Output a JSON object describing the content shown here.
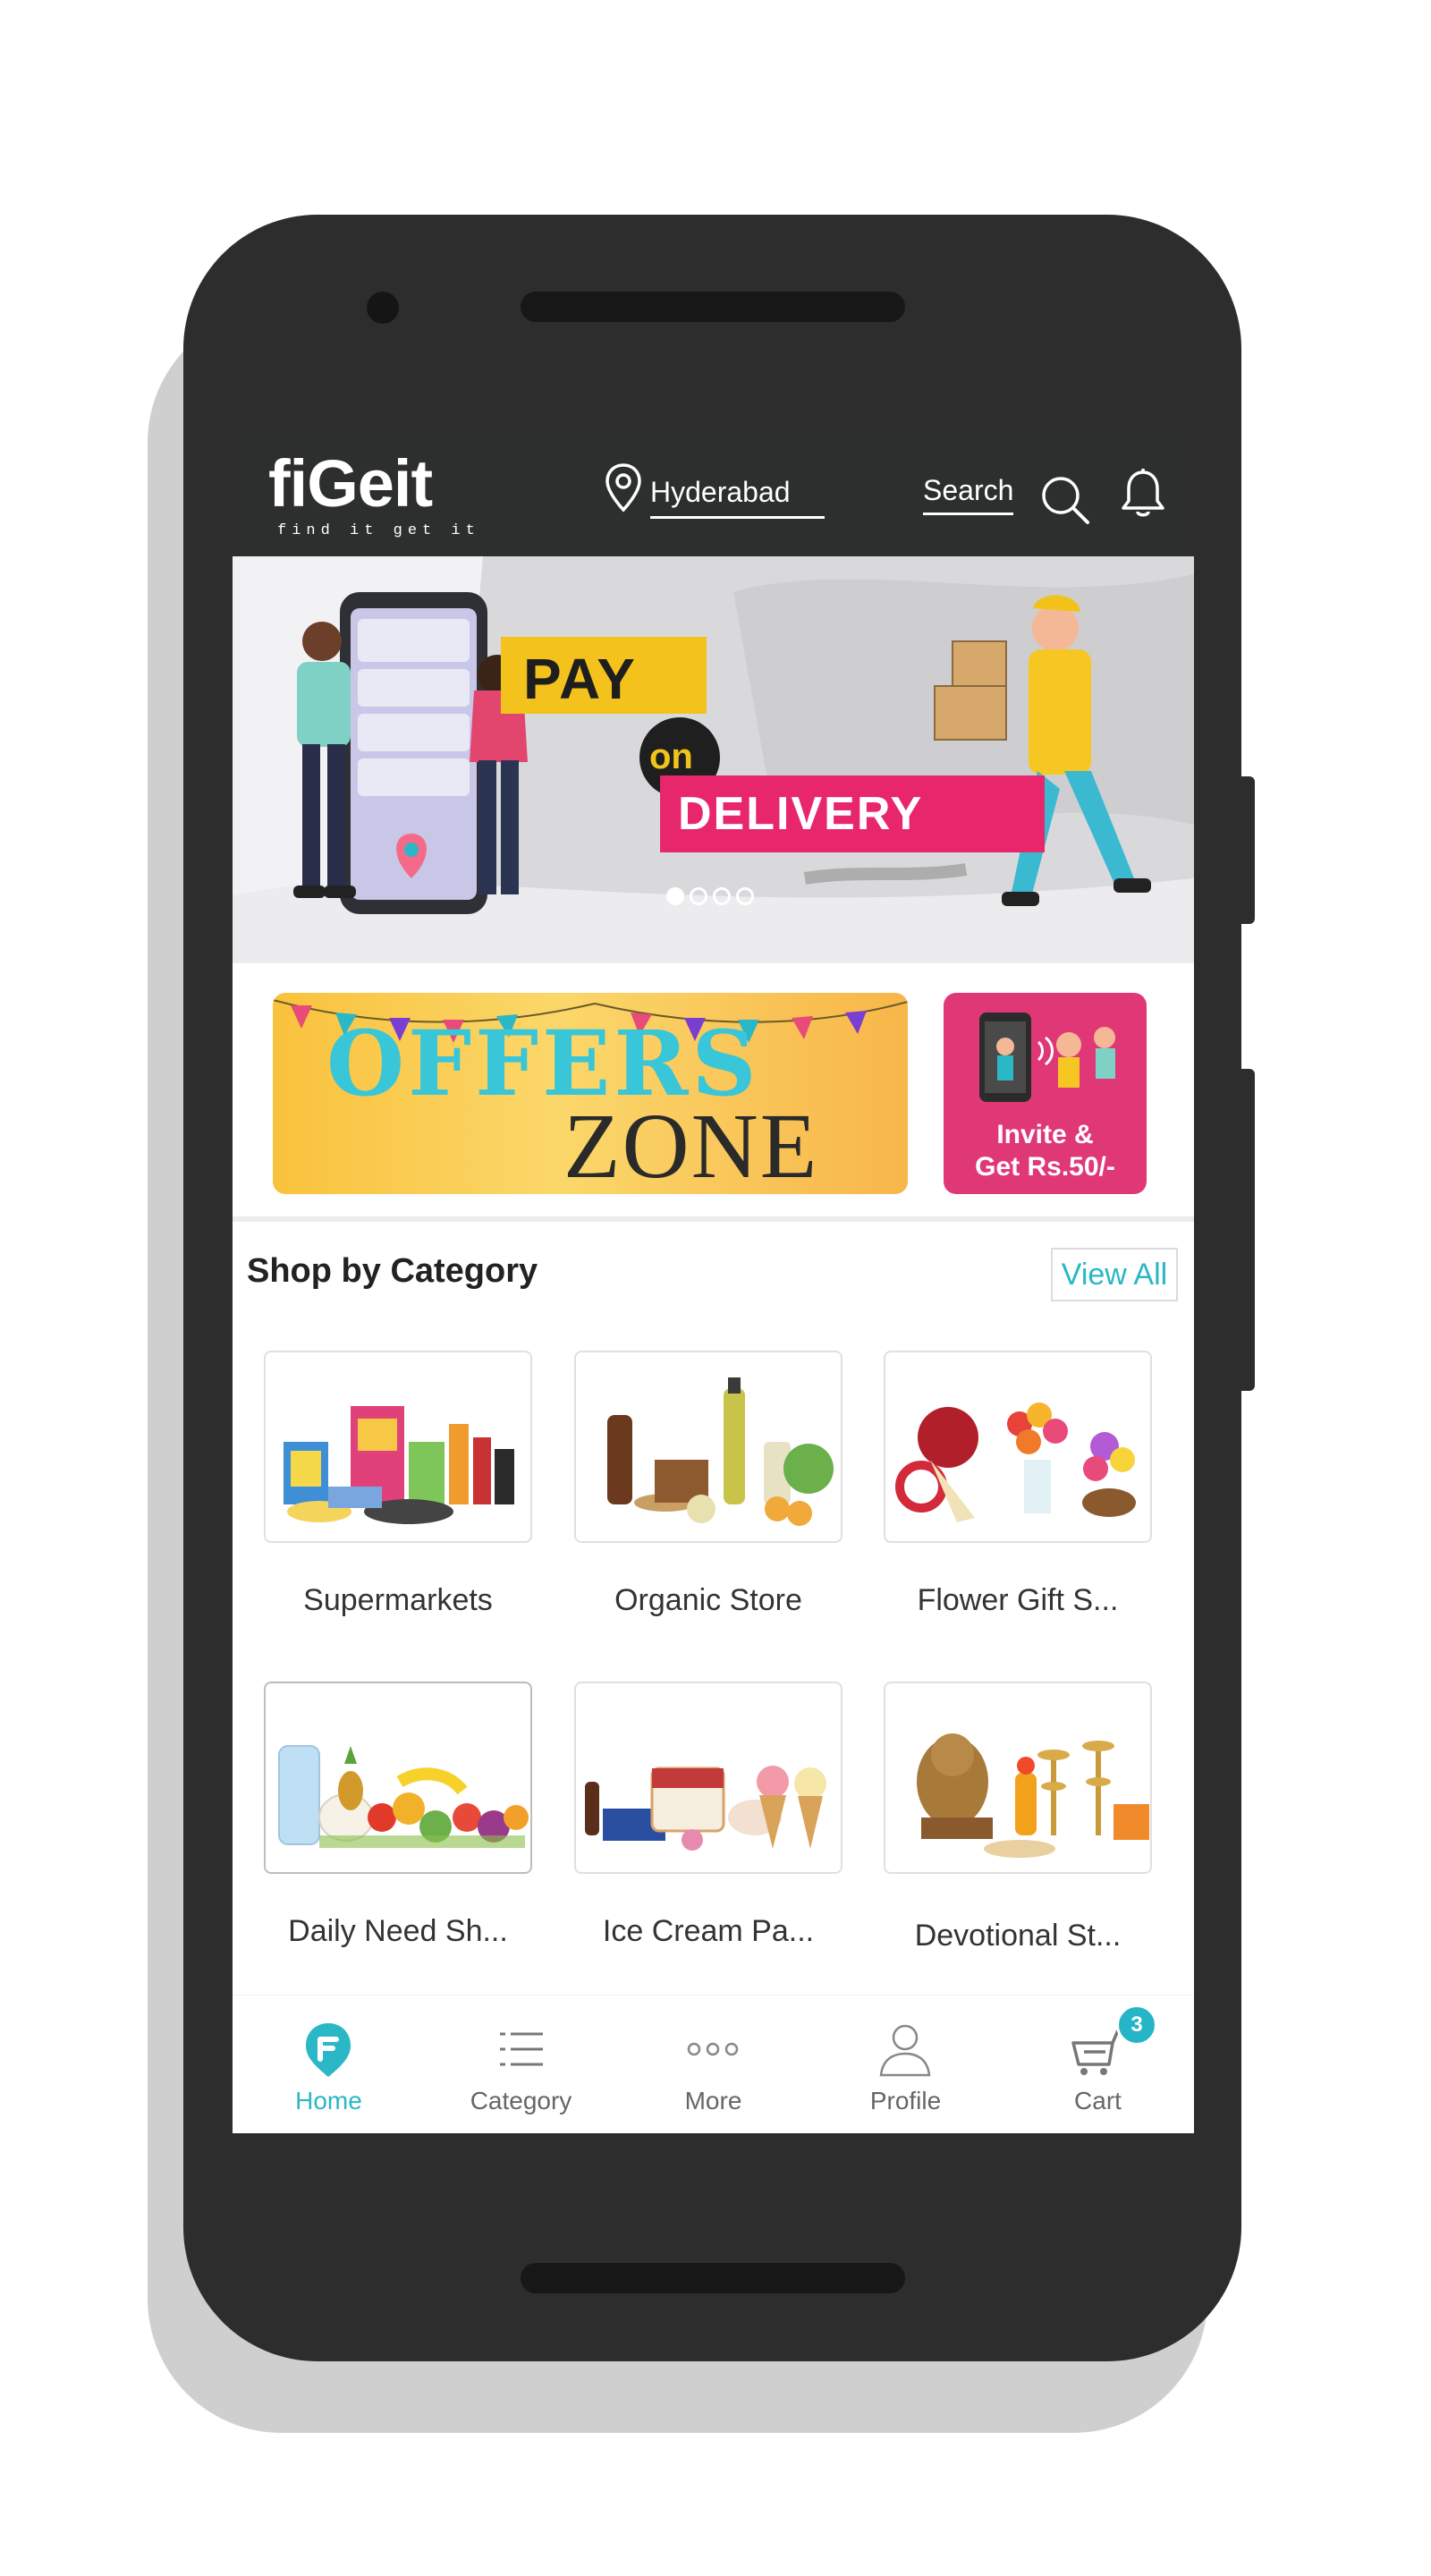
{
  "header": {
    "logo_text": "fiGeit",
    "logo_tagline": "find it get it",
    "location": "Hyderabad",
    "search_label": "Search"
  },
  "banner": {
    "line1": "PAY",
    "line2": "on",
    "line3": "DELIVERY",
    "slide_count": 4,
    "active_slide": 0
  },
  "offers": {
    "title": "OFFERS",
    "subtitle": "ZONE",
    "invite_line1": "Invite & ",
    "invite_line2": "Get Rs.50/-"
  },
  "category_section": {
    "title": "Shop by Category",
    "view_all": "View All",
    "items": [
      {
        "label": "Supermarkets",
        "icon": "supermarket-products"
      },
      {
        "label": "Organic Store",
        "icon": "organic-products"
      },
      {
        "label": "Flower Gift S...",
        "icon": "flower-bouquets"
      },
      {
        "label": "Daily Need Sh...",
        "icon": "fruits-vegetables"
      },
      {
        "label": "Ice Cream Pa...",
        "icon": "ice-creams"
      },
      {
        "label": "Devotional St...",
        "icon": "devotional-items"
      }
    ]
  },
  "bottom_nav": {
    "items": [
      {
        "label": "Home",
        "icon": "home-logo-icon",
        "active": true
      },
      {
        "label": "Category",
        "icon": "list-icon",
        "active": false
      },
      {
        "label": "More",
        "icon": "more-dots-icon",
        "active": false
      },
      {
        "label": "Profile",
        "icon": "person-icon",
        "active": false
      },
      {
        "label": "Cart",
        "icon": "cart-icon",
        "active": false
      }
    ],
    "cart_count": "3"
  },
  "colors": {
    "accent": "#2ab7c6",
    "header_bg": "#2c2f2e",
    "phone_body": "#2d2d2d"
  }
}
